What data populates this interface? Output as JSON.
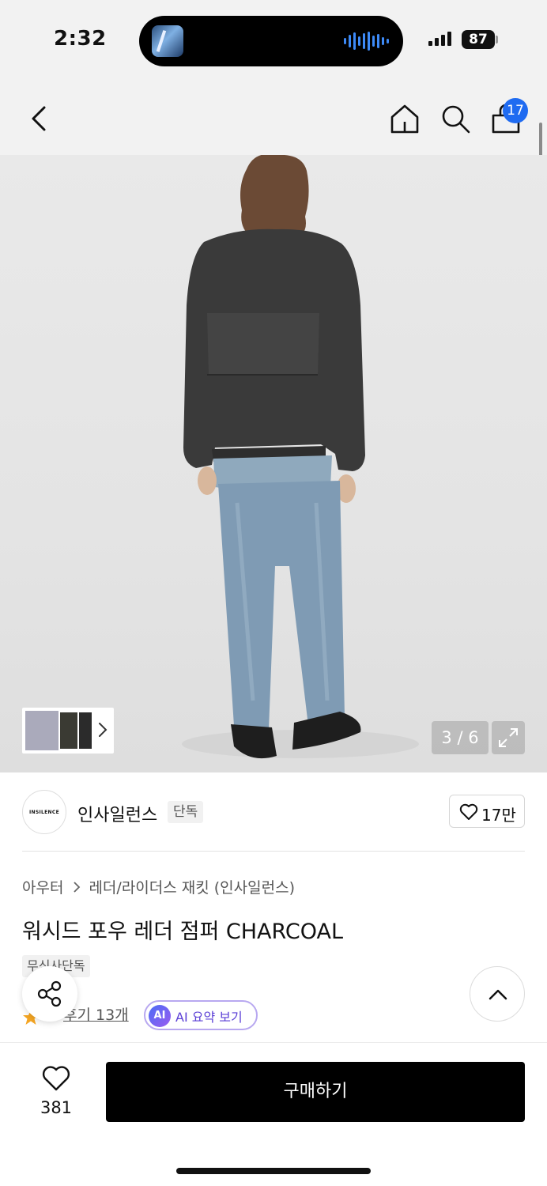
{
  "status_bar": {
    "time": "2:32",
    "battery": "87"
  },
  "header": {
    "cart_badge": "17"
  },
  "gallery": {
    "page_counter": "3 / 6",
    "current_page": 3,
    "total_pages": 6
  },
  "brand": {
    "logo_text": "INSILENCE",
    "name": "인사일런스",
    "tag": "단독",
    "likes": "17만"
  },
  "product": {
    "breadcrumb": [
      "아우터",
      "레더/라이더스 재킷 (인사일런스)"
    ],
    "title": "워시드 포우 레더 점퍼 CHARCOAL",
    "exclusive_tag": "무신사단독",
    "reviews": "후기 13개",
    "ai_badge": "AI",
    "ai_summary": "AI 요약 보기"
  },
  "bottom_bar": {
    "wish_count": "381",
    "buy_label": "구매하기"
  },
  "colors": {
    "accent_blue": "#1f6bf1",
    "buy_button": "#000000",
    "rating_star": "#f5a623",
    "ai_purple": "#5b3fd6"
  },
  "icons": [
    "back-icon",
    "home-icon",
    "search-icon",
    "cart-icon",
    "chevron-right-icon",
    "expand-icon",
    "heart-icon",
    "share-icon",
    "chevron-up-icon",
    "star-icon"
  ]
}
